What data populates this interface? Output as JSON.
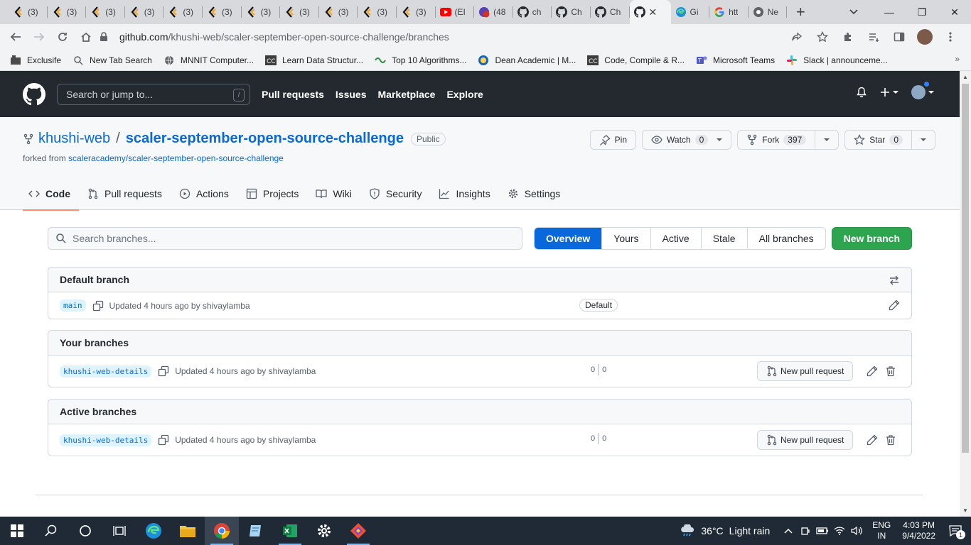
{
  "browser": {
    "tabs": [
      {
        "label": "(3)",
        "icon": "scaler-icon"
      },
      {
        "label": "(3)",
        "icon": "scaler-icon"
      },
      {
        "label": "(3)",
        "icon": "scaler-icon"
      },
      {
        "label": "(3)",
        "icon": "scaler-icon"
      },
      {
        "label": "(3)",
        "icon": "scaler-icon"
      },
      {
        "label": "(3)",
        "icon": "scaler-icon"
      },
      {
        "label": "(3)",
        "icon": "scaler-icon"
      },
      {
        "label": "(3)",
        "icon": "scaler-icon"
      },
      {
        "label": "(3)",
        "icon": "scaler-icon"
      },
      {
        "label": "(3)",
        "icon": "scaler-icon"
      },
      {
        "label": "(3)",
        "icon": "scaler-icon"
      },
      {
        "label": "(EI",
        "icon": "youtube-icon"
      },
      {
        "label": "(48",
        "icon": "badge-icon"
      },
      {
        "label": "ch",
        "icon": "github-icon"
      },
      {
        "label": "Ch",
        "icon": "github-icon"
      },
      {
        "label": "Ch",
        "icon": "github-icon"
      },
      {
        "label": "",
        "icon": "github-icon",
        "active": true
      },
      {
        "label": "Gi",
        "icon": "edge-icon"
      },
      {
        "label": "htt",
        "icon": "google-icon"
      },
      {
        "label": "Ne",
        "icon": "chrome-icon"
      }
    ],
    "url_host": "github.com",
    "url_path": "/khushi-web/scaler-september-open-source-challenge/branches",
    "bookmarks": [
      "Exclusife",
      "New Tab Search",
      "MNNIT Computer...",
      "Learn Data Structur...",
      "Top 10 Algorithms...",
      "Dean Academic | M...",
      "Code, Compile & R...",
      "Microsoft Teams",
      "Slack | announceme..."
    ]
  },
  "github": {
    "search_placeholder": "Search or jump to...",
    "search_key": "/",
    "nav": [
      "Pull requests",
      "Issues",
      "Marketplace",
      "Explore"
    ],
    "owner": "khushi-web",
    "repo": "scaler-september-open-source-challenge",
    "visibility": "Public",
    "forked_from_label": "forked from",
    "forked_from": "scaleracademy/scaler-september-open-source-challenge",
    "pin": "Pin",
    "watch": "Watch",
    "watch_count": "0",
    "fork": "Fork",
    "fork_count": "397",
    "star": "Star",
    "star_count": "0",
    "repo_tabs": [
      "Code",
      "Pull requests",
      "Actions",
      "Projects",
      "Wiki",
      "Security",
      "Insights",
      "Settings"
    ]
  },
  "branches": {
    "search_placeholder": "Search branches...",
    "filters": [
      "Overview",
      "Yours",
      "Active",
      "Stale",
      "All branches"
    ],
    "selected_filter": "Overview",
    "new_branch": "New branch",
    "sections": [
      {
        "title": "Default branch",
        "rows": [
          {
            "name": "main",
            "updated": "Updated 4 hours ago by shivaylamba",
            "badge": "Default"
          }
        ]
      },
      {
        "title": "Your branches",
        "rows": [
          {
            "name": "khushi-web-details",
            "updated": "Updated 4 hours ago by shivaylamba",
            "behind": "0",
            "ahead": "0",
            "pr": "New pull request"
          }
        ]
      },
      {
        "title": "Active branches",
        "rows": [
          {
            "name": "khushi-web-details",
            "updated": "Updated 4 hours ago by shivaylamba",
            "behind": "0",
            "ahead": "0",
            "pr": "New pull request"
          }
        ]
      }
    ]
  },
  "taskbar": {
    "weather_temp": "36°C",
    "weather_text": "Light rain",
    "lang1": "ENG",
    "lang2": "IN",
    "time": "4:03 PM",
    "date": "9/4/2022",
    "notifications": "1"
  }
}
